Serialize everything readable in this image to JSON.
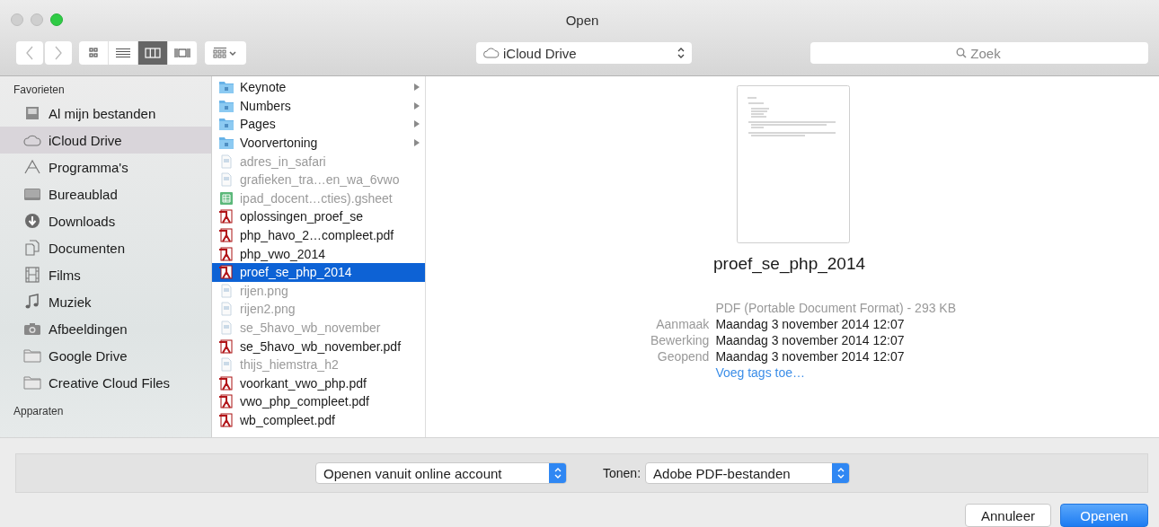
{
  "window": {
    "title": "Open"
  },
  "toolbar": {
    "view_modes": [
      {
        "kind": "icons",
        "selected": false
      },
      {
        "kind": "list",
        "selected": false
      },
      {
        "kind": "columns",
        "selected": true
      },
      {
        "kind": "coverflow",
        "selected": false
      }
    ],
    "location": "iCloud Drive",
    "search": {
      "placeholder": "Zoek"
    }
  },
  "sidebar": {
    "sections": [
      {
        "title": "Favorieten",
        "items": [
          {
            "label": "Al mijn bestanden",
            "kind": "allfiles",
            "selected": false
          },
          {
            "label": "iCloud Drive",
            "kind": "cloud",
            "selected": true
          },
          {
            "label": "Programma's",
            "kind": "apps",
            "selected": false
          },
          {
            "label": "Bureaublad",
            "kind": "desktop",
            "selected": false
          },
          {
            "label": "Downloads",
            "kind": "downloads",
            "selected": false
          },
          {
            "label": "Documenten",
            "kind": "documents",
            "selected": false
          },
          {
            "label": "Films",
            "kind": "films",
            "selected": false
          },
          {
            "label": "Muziek",
            "kind": "music",
            "selected": false
          },
          {
            "label": "Afbeeldingen",
            "kind": "camera",
            "selected": false
          },
          {
            "label": "Google Drive",
            "kind": "folder",
            "selected": false
          },
          {
            "label": "Creative Cloud Files",
            "kind": "folder",
            "selected": false
          }
        ]
      },
      {
        "title": "Apparaten"
      }
    ]
  },
  "files": [
    {
      "name": "Keynote",
      "kind": "folder",
      "disabled": false,
      "selected": false,
      "expandable": true
    },
    {
      "name": "Numbers",
      "kind": "folder",
      "disabled": false,
      "selected": false,
      "expandable": true
    },
    {
      "name": "Pages",
      "kind": "folder",
      "disabled": false,
      "selected": false,
      "expandable": true
    },
    {
      "name": "Voorvertoning",
      "kind": "folder",
      "disabled": false,
      "selected": false,
      "expandable": true
    },
    {
      "name": "adres_in_safari",
      "kind": "doc",
      "disabled": true,
      "selected": false,
      "expandable": false
    },
    {
      "name": "grafieken_tra…en_wa_6vwo",
      "kind": "doc",
      "disabled": true,
      "selected": false,
      "expandable": false
    },
    {
      "name": "ipad_docent…cties).gsheet",
      "kind": "sheet",
      "disabled": true,
      "selected": false,
      "expandable": false
    },
    {
      "name": "oplossingen_proef_se",
      "kind": "pdf",
      "disabled": false,
      "selected": false,
      "expandable": false
    },
    {
      "name": "php_havo_2…compleet.pdf",
      "kind": "pdf",
      "disabled": false,
      "selected": false,
      "expandable": false
    },
    {
      "name": "php_vwo_2014",
      "kind": "pdf",
      "disabled": false,
      "selected": false,
      "expandable": false
    },
    {
      "name": "proef_se_php_2014",
      "kind": "pdf",
      "disabled": false,
      "selected": true,
      "expandable": false
    },
    {
      "name": "rijen.png",
      "kind": "doc",
      "disabled": true,
      "selected": false,
      "expandable": false
    },
    {
      "name": "rijen2.png",
      "kind": "doc",
      "disabled": true,
      "selected": false,
      "expandable": false
    },
    {
      "name": "se_5havo_wb_november",
      "kind": "doc",
      "disabled": true,
      "selected": false,
      "expandable": false
    },
    {
      "name": "se_5havo_wb_november.pdf",
      "kind": "pdf",
      "disabled": false,
      "selected": false,
      "expandable": false
    },
    {
      "name": "thijs_hiemstra_h2",
      "kind": "doc",
      "disabled": true,
      "selected": false,
      "expandable": false
    },
    {
      "name": "voorkant_vwo_php.pdf",
      "kind": "pdf",
      "disabled": false,
      "selected": false,
      "expandable": false
    },
    {
      "name": "vwo_php_compleet.pdf",
      "kind": "pdf",
      "disabled": false,
      "selected": false,
      "expandable": false
    },
    {
      "name": "wb_compleet.pdf",
      "kind": "pdf",
      "disabled": false,
      "selected": false,
      "expandable": false
    }
  ],
  "preview": {
    "name": "proef_se_php_2014",
    "kind_size": "PDF (Portable Document Format) - 293 KB",
    "details": [
      {
        "label": "Aanmaak",
        "value": "Maandag 3 november 2014 12:07"
      },
      {
        "label": "Bewerking",
        "value": "Maandag 3 november 2014 12:07"
      },
      {
        "label": "Geopend",
        "value": "Maandag 3 november 2014 12:07"
      }
    ],
    "tags_link": "Voeg tags toe…"
  },
  "options": {
    "source": "Openen vanuit online account",
    "filter_label": "Tonen:",
    "filter": "Adobe PDF-bestanden"
  },
  "buttons": [
    {
      "label": "Annuleer",
      "kind": "default"
    },
    {
      "label": "Openen",
      "kind": "primary"
    }
  ]
}
